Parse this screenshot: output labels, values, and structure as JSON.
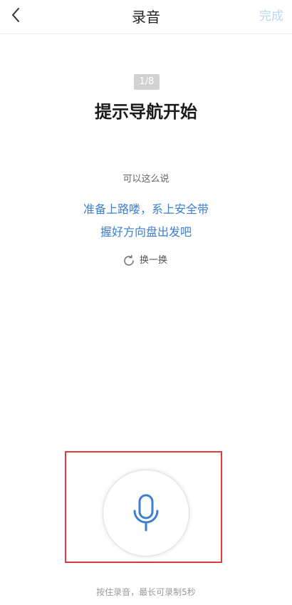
{
  "header": {
    "title": "录音",
    "done_label": "完成",
    "back_icon": "chevron-left-icon"
  },
  "step": {
    "indicator": "1/8"
  },
  "scene": {
    "title": "提示导航开始"
  },
  "suggestion": {
    "label": "可以这么说",
    "lines": [
      "准备上路喽，系上安全带",
      "握好方向盘出发吧"
    ],
    "refresh_label": "换一换",
    "refresh_icon": "refresh-icon"
  },
  "record": {
    "mic_icon": "microphone-icon",
    "tip": "按住录音，最长可录制5秒"
  },
  "colors": {
    "accent": "#3b7fcf",
    "done_disabled": "#bcd6f2",
    "highlight": "#e03a3a"
  }
}
